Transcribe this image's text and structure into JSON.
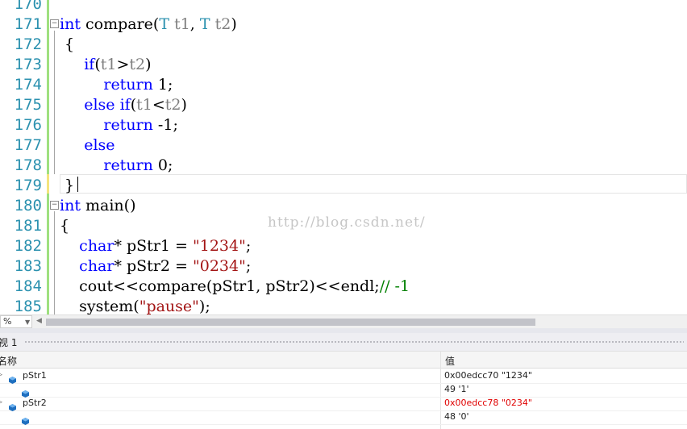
{
  "editor": {
    "lines": [
      {
        "num": "170",
        "tokens": []
      },
      {
        "num": "171",
        "tokens": [
          {
            "t": "int",
            "c": "kw"
          },
          {
            "t": " compare(",
            "c": ""
          },
          {
            "t": "T",
            "c": "ty"
          },
          {
            "t": " ",
            "c": ""
          },
          {
            "t": "t1",
            "c": "pm"
          },
          {
            "t": ", ",
            "c": ""
          },
          {
            "t": "T",
            "c": "ty"
          },
          {
            "t": " ",
            "c": ""
          },
          {
            "t": "t2",
            "c": "pm"
          },
          {
            "t": ")",
            "c": ""
          }
        ]
      },
      {
        "num": "172",
        "tokens": [
          {
            "t": " {",
            "c": ""
          }
        ]
      },
      {
        "num": "173",
        "tokens": [
          {
            "t": "     ",
            "c": ""
          },
          {
            "t": "if",
            "c": "kw"
          },
          {
            "t": "(",
            "c": ""
          },
          {
            "t": "t1",
            "c": "pm"
          },
          {
            "t": ">",
            "c": ""
          },
          {
            "t": "t2",
            "c": "pm"
          },
          {
            "t": ")",
            "c": ""
          }
        ]
      },
      {
        "num": "174",
        "tokens": [
          {
            "t": "         ",
            "c": ""
          },
          {
            "t": "return",
            "c": "kw"
          },
          {
            "t": " 1;",
            "c": ""
          }
        ]
      },
      {
        "num": "175",
        "tokens": [
          {
            "t": "     ",
            "c": ""
          },
          {
            "t": "else",
            "c": "kw"
          },
          {
            "t": " ",
            "c": ""
          },
          {
            "t": "if",
            "c": "kw"
          },
          {
            "t": "(",
            "c": ""
          },
          {
            "t": "t1",
            "c": "pm"
          },
          {
            "t": "<",
            "c": ""
          },
          {
            "t": "t2",
            "c": "pm"
          },
          {
            "t": ")",
            "c": ""
          }
        ]
      },
      {
        "num": "176",
        "tokens": [
          {
            "t": "         ",
            "c": ""
          },
          {
            "t": "return",
            "c": "kw"
          },
          {
            "t": " -1;",
            "c": ""
          }
        ]
      },
      {
        "num": "177",
        "tokens": [
          {
            "t": "     ",
            "c": ""
          },
          {
            "t": "else",
            "c": "kw"
          }
        ]
      },
      {
        "num": "178",
        "tokens": [
          {
            "t": "         ",
            "c": ""
          },
          {
            "t": "return",
            "c": "kw"
          },
          {
            "t": " 0;",
            "c": ""
          }
        ]
      },
      {
        "num": "179",
        "tokens": [
          {
            "t": " }",
            "c": ""
          }
        ]
      },
      {
        "num": "180",
        "tokens": [
          {
            "t": "int",
            "c": "kw"
          },
          {
            "t": " main()",
            "c": ""
          }
        ]
      },
      {
        "num": "181",
        "tokens": [
          {
            "t": "{",
            "c": ""
          }
        ]
      },
      {
        "num": "182",
        "tokens": [
          {
            "t": "    ",
            "c": ""
          },
          {
            "t": "char",
            "c": "kw"
          },
          {
            "t": "* pStr1 = ",
            "c": ""
          },
          {
            "t": "\"1234\"",
            "c": "st"
          },
          {
            "t": ";",
            "c": ""
          }
        ]
      },
      {
        "num": "183",
        "tokens": [
          {
            "t": "    ",
            "c": ""
          },
          {
            "t": "char",
            "c": "kw"
          },
          {
            "t": "* pStr2 = ",
            "c": ""
          },
          {
            "t": "\"0234\"",
            "c": "st"
          },
          {
            "t": ";",
            "c": ""
          }
        ]
      },
      {
        "num": "184",
        "tokens": [
          {
            "t": "    cout<<compare(pStr1, pStr2)<<endl;",
            "c": ""
          },
          {
            "t": "// -1",
            "c": "cm"
          }
        ]
      },
      {
        "num": "185",
        "tokens": [
          {
            "t": "    system(",
            "c": ""
          },
          {
            "t": "\"pause\"",
            "c": "st"
          },
          {
            "t": ");",
            "c": ""
          }
        ]
      }
    ],
    "watermark": "http://blog.csdn.net/"
  },
  "statusbar": {
    "zoom": "%"
  },
  "watch": {
    "title": "视 1",
    "col_name": "名称",
    "col_value": "值",
    "rows": [
      {
        "name": "pStr1",
        "value": "0x00edcc70 \"1234\"",
        "changed": false,
        "child": false
      },
      {
        "name": "",
        "value": "49 '1'",
        "changed": false,
        "child": true
      },
      {
        "name": "pStr2",
        "value": "0x00edcc78 \"0234\"",
        "changed": true,
        "child": false
      },
      {
        "name": "",
        "value": "48 '0'",
        "changed": false,
        "child": true
      }
    ]
  },
  "colors": {
    "keyword": "#0000ff",
    "type": "#2b91af",
    "string": "#a31515",
    "comment": "#008000",
    "changed_value": "#e00000"
  }
}
